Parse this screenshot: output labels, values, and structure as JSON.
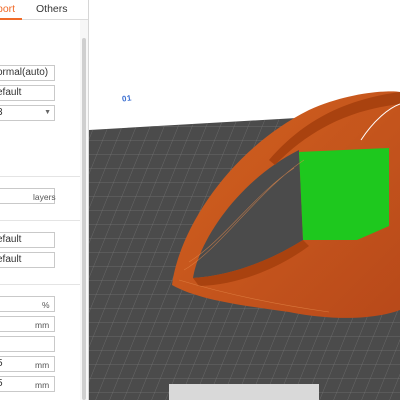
{
  "tabs": {
    "support": "port",
    "others": "Others"
  },
  "fields": {
    "f1": "ormal(auto)",
    "f2": "efault",
    "f3": "3",
    "f4": "",
    "f5": "efault",
    "f6": "efault",
    "f7": "",
    "f8": "",
    "f9": "",
    "f10": "5",
    "f11": "5"
  },
  "units": {
    "layers": "layers",
    "percent": "%",
    "mm1": "mm",
    "mm2": "mm",
    "mm3": "mm"
  },
  "viewport": {
    "plate_number": "01",
    "colors": {
      "plate": "#4a4a4a",
      "grid": "#7a7a7a",
      "model_outer": "#c8561a",
      "model_inner": "#a9420f",
      "support_fill": "#1ec81e",
      "accent": "#f06a28"
    }
  }
}
